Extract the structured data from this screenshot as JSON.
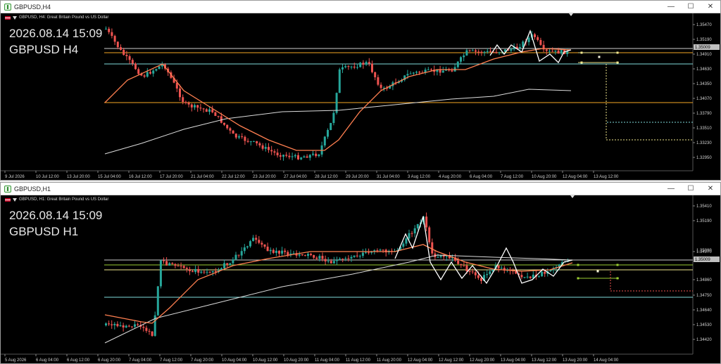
{
  "windows": [
    {
      "id": "h4",
      "title": "GBPUSD,H4",
      "header": "GBPUSD, H4:  Great Britain Pound vs US Dollar",
      "overlay_datetime": "2026.08.14 15:09",
      "overlay_symbol": "GBPUSD H4",
      "price_labels": [
        "1.35470",
        "1.35190",
        "1.34910",
        "1.34630",
        "1.34350",
        "1.34070",
        "1.33790",
        "1.33510",
        "1.33230",
        "1.32950"
      ],
      "current_price": "1.35009",
      "time_labels": [
        "9 Jul 2026",
        "10 Jul 12:00",
        "13 Jul 20:00",
        "15 Jul 04:00",
        "16 Jul 12:00",
        "17 Jul 20:00",
        "21 Jul 04:00",
        "22 Jul 12:00",
        "23 Jul 20:00",
        "27 Jul 04:00",
        "28 Jul 12:00",
        "29 Jul 20:00",
        "31 Jul 04:00",
        "3 Aug 12:00",
        "4 Aug 20:00",
        "6 Aug 04:00",
        "7 Aug 12:00",
        "10 Aug 20:00",
        "12 Aug 04:00",
        "13 Aug 12:00"
      ]
    },
    {
      "id": "h1",
      "title": "GBPUSD,H1",
      "header": "GBPUSD, H1:  Great Britain Pound vs US Dollar",
      "overlay_datetime": "2026.08.14 15:09",
      "overlay_symbol": "GBPUSD H1",
      "price_labels": [
        "1.35410",
        "1.35190",
        "1.34970",
        "1.34860",
        "1.34750",
        "1.34640",
        "1.34530",
        "1.34420"
      ],
      "extra_price_label": "1.35080",
      "current_price": "1.35009",
      "time_labels": [
        "5 Aug 2026",
        "6 Aug 04:00",
        "6 Aug 12:00",
        "6 Aug 20:00",
        "7 Aug 04:00",
        "7 Aug 12:00",
        "7 Aug 20:00",
        "10 Aug 04:00",
        "10 Aug 12:00",
        "10 Aug 20:00",
        "11 Aug 04:00",
        "11 Aug 12:00",
        "11 Aug 20:00",
        "12 Aug 04:00",
        "12 Aug 12:00",
        "12 Aug 20:00",
        "13 Aug 04:00",
        "13 Aug 12:00",
        "13 Aug 20:00",
        "14 Aug 04:00"
      ]
    }
  ],
  "window_controls": {
    "minimize": "—",
    "maximize": "☐",
    "close": "✕"
  },
  "colors": {
    "bull": "#26a69a",
    "bear": "#ef5350",
    "ma_fast": "#ff7f50",
    "ma_slow": "#dcdcdc",
    "level_orange": "#f5a623",
    "level_yellow": "#f0e68c",
    "level_cyan": "#7fdbdb",
    "level_green": "#9acd32"
  }
}
